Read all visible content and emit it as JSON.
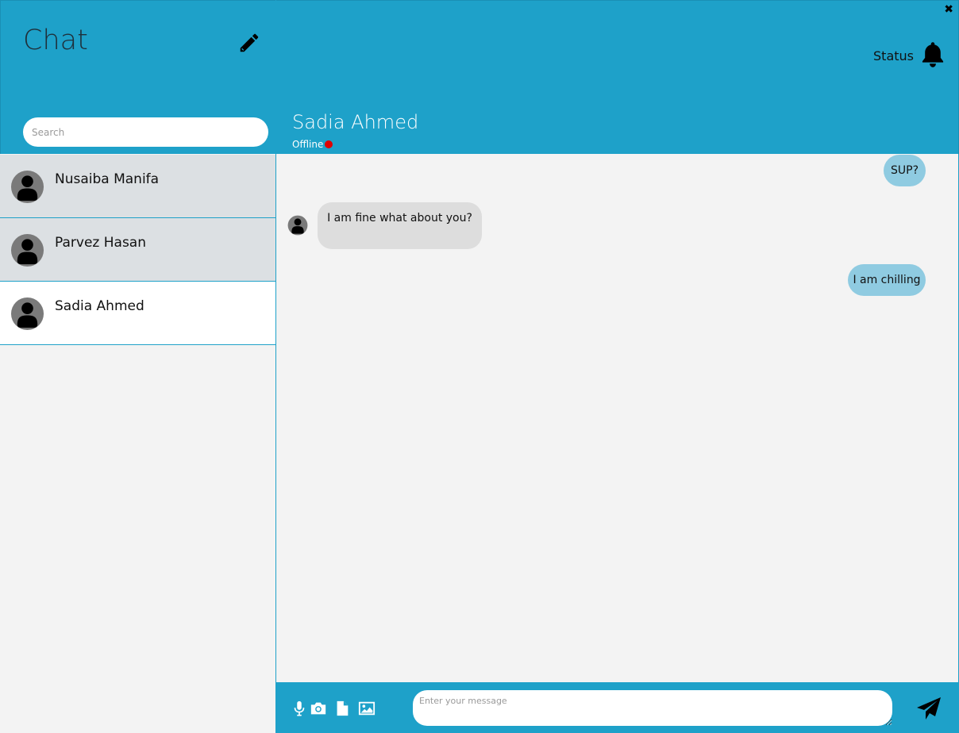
{
  "sidebar": {
    "title": "Chat",
    "search_placeholder": "Search",
    "contacts": [
      {
        "name": "Nusaiba Manifa",
        "active": false
      },
      {
        "name": "Parvez Hasan",
        "active": false
      },
      {
        "name": "Sadia Ahmed",
        "active": true
      }
    ]
  },
  "header": {
    "status_label": "Status",
    "peer_name": "Sadia Ahmed",
    "peer_status": "Offline",
    "close_symbol": "✖"
  },
  "messages": [
    {
      "text": "SUP?",
      "direction": "outgoing"
    },
    {
      "text": "I am fine what about you?",
      "direction": "incoming"
    },
    {
      "text": "I am chilling",
      "direction": "outgoing"
    }
  ],
  "composer": {
    "placeholder": "Enter your message"
  },
  "icons": {
    "edit": "pencil-icon",
    "notification": "bell-icon",
    "microphone": "microphone-icon",
    "camera": "camera-icon",
    "file": "file-icon",
    "image": "image-icon",
    "send": "send-icon",
    "avatar": "user-avatar-icon"
  },
  "colors": {
    "accent": "#1ea1c9",
    "outgoing_bubble": "#8fcbe1",
    "incoming_bubble": "#dddddd",
    "contact_bg": "#dce0e3",
    "offline_dot": "#e00000"
  }
}
